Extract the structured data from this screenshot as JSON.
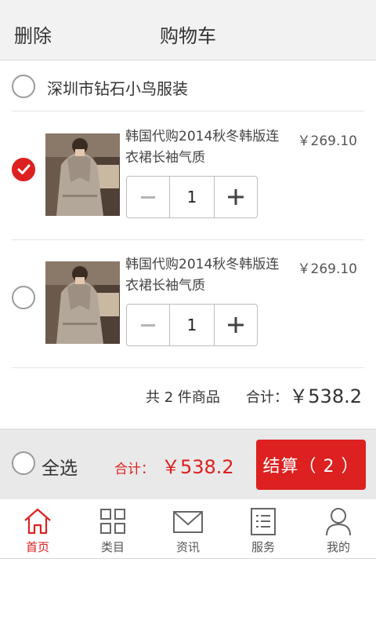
{
  "header": {
    "delete_label": "删除",
    "title": "购物车"
  },
  "store": {
    "name": "深圳市钻石小鸟服装",
    "checked": false
  },
  "items": [
    {
      "title": "韩国代购2014秋冬韩版连衣裙长袖气质",
      "price": "￥269.10",
      "quantity": "1",
      "checked": true
    },
    {
      "title": "韩国代购2014秋冬韩版连衣裙长袖气质",
      "price": "￥269.10",
      "quantity": "1",
      "checked": false
    }
  ],
  "summary": {
    "count_prefix": "共",
    "count": "2",
    "count_suffix": "件商品",
    "total_label": "合计：",
    "total_value": "￥538.2"
  },
  "checkout_bar": {
    "select_all_label": "全选",
    "total_label": "合计：",
    "total_value": "￥538.2",
    "checkout_label": "结算（ 2 ）"
  },
  "tabs": [
    {
      "label": "首页",
      "icon": "home-icon",
      "active": true
    },
    {
      "label": "类目",
      "icon": "grid-icon",
      "active": false
    },
    {
      "label": "资讯",
      "icon": "mail-icon",
      "active": false
    },
    {
      "label": "服务",
      "icon": "list-icon",
      "active": false
    },
    {
      "label": "我的",
      "icon": "user-icon",
      "active": false
    }
  ],
  "colors": {
    "accent": "#dd2020",
    "topbar_bg": "#f2f2f2",
    "checkout_bar_bg": "#e9e9e9"
  }
}
